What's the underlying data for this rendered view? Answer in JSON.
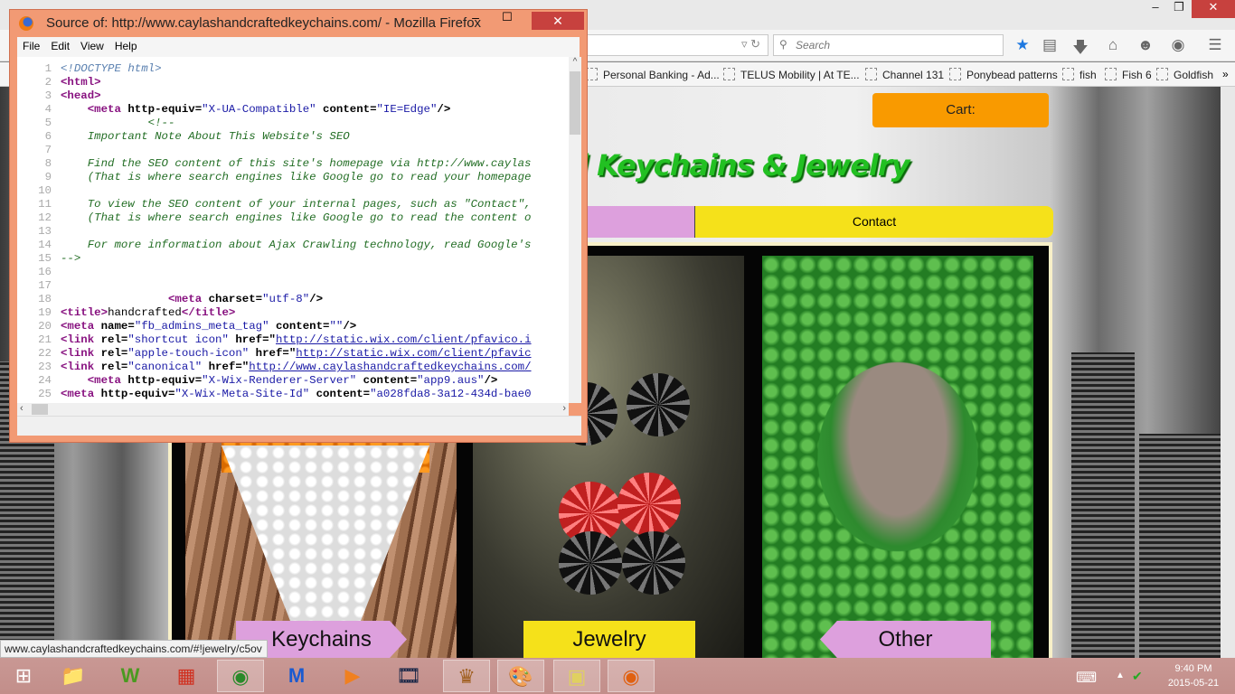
{
  "browser": {
    "search_placeholder": "Search",
    "bookmarks": [
      "Personal Banking - Ad...",
      "TELUS Mobility | At TE...",
      "Channel 131",
      "Ponybead patterns",
      "fish",
      "Fish 6",
      "Goldfish"
    ],
    "bookmarks_overflow": "»",
    "status_url": "www.caylashandcraftedkeychains.com/#!jewelry/c5ov",
    "accent": "#1e78e0"
  },
  "site": {
    "cart_label": "Cart:",
    "title": "l Keychains & Jewelry",
    "nav_contact": "Contact",
    "labels": {
      "keychains": "Keychains",
      "jewelry": "Jewelry",
      "other": "Other"
    },
    "colors": {
      "cart": "#f99a00",
      "title": "#22c022",
      "pink": "#dda0dd",
      "yellow": "#f5e11a"
    }
  },
  "source_window": {
    "title": "Source of: http://www.caylashandcraftedkeychains.com/ - Mozilla Firefox",
    "menu": [
      "File",
      "Edit",
      "View",
      "Help"
    ],
    "close_color": "#c7413e",
    "lines": [
      [
        {
          "t": "dt",
          "v": "<!DOCTYPE html>"
        }
      ],
      [
        {
          "t": "tg",
          "v": "<html>"
        }
      ],
      [
        {
          "t": "tg",
          "v": "<head>"
        }
      ],
      [
        {
          "t": "",
          "v": "    "
        },
        {
          "t": "tg",
          "v": "<meta "
        },
        {
          "t": "at",
          "v": "http-equiv="
        },
        {
          "t": "av",
          "v": "\"X-UA-Compatible\""
        },
        {
          "t": "at",
          "v": " content="
        },
        {
          "t": "av",
          "v": "\"IE=Edge\""
        },
        {
          "t": "at",
          "v": "/>"
        }
      ],
      [
        {
          "t": "cm",
          "v": "             <!--"
        }
      ],
      [
        {
          "t": "cm",
          "v": "    Important Note About This Website's SEO"
        }
      ],
      [],
      [
        {
          "t": "cm",
          "v": "    Find the SEO content of this site's homepage via http://www.caylas"
        }
      ],
      [
        {
          "t": "cm",
          "v": "    (That is where search engines like Google go to read your homepage"
        }
      ],
      [],
      [
        {
          "t": "cm",
          "v": "    To view the SEO content of your internal pages, such as \"Contact\","
        }
      ],
      [
        {
          "t": "cm",
          "v": "    (That is where search engines like Google go to read the content o"
        }
      ],
      [],
      [
        {
          "t": "cm",
          "v": "    For more information about Ajax Crawling technology, read Google's"
        }
      ],
      [
        {
          "t": "cm",
          "v": "-->"
        }
      ],
      [],
      [],
      [
        {
          "t": "",
          "v": "                "
        },
        {
          "t": "tg",
          "v": "<meta "
        },
        {
          "t": "at",
          "v": "charset="
        },
        {
          "t": "av",
          "v": "\"utf-8\""
        },
        {
          "t": "at",
          "v": "/>"
        }
      ],
      [
        {
          "t": "tg",
          "v": "<title>"
        },
        {
          "t": "",
          "v": "handcrafted"
        },
        {
          "t": "tg",
          "v": "</title>"
        }
      ],
      [
        {
          "t": "tg",
          "v": "<meta "
        },
        {
          "t": "at",
          "v": "name="
        },
        {
          "t": "av",
          "v": "\"fb_admins_meta_tag\""
        },
        {
          "t": "at",
          "v": " content="
        },
        {
          "t": "av",
          "v": "\"\""
        },
        {
          "t": "at",
          "v": "/>"
        }
      ],
      [
        {
          "t": "tg",
          "v": "<link "
        },
        {
          "t": "at",
          "v": "rel="
        },
        {
          "t": "av",
          "v": "\"shortcut icon\""
        },
        {
          "t": "at",
          "v": " href=\""
        },
        {
          "t": "lk",
          "v": "http://static.wix.com/client/pfavico.i"
        }
      ],
      [
        {
          "t": "tg",
          "v": "<link "
        },
        {
          "t": "at",
          "v": "rel="
        },
        {
          "t": "av",
          "v": "\"apple-touch-icon\""
        },
        {
          "t": "at",
          "v": " href=\""
        },
        {
          "t": "lk",
          "v": "http://static.wix.com/client/pfavic"
        }
      ],
      [
        {
          "t": "tg",
          "v": "<link "
        },
        {
          "t": "at",
          "v": "rel="
        },
        {
          "t": "av",
          "v": "\"canonical\""
        },
        {
          "t": "at",
          "v": " href=\""
        },
        {
          "t": "lk",
          "v": "http://www.caylashandcraftedkeychains.com/"
        }
      ],
      [
        {
          "t": "",
          "v": "    "
        },
        {
          "t": "tg",
          "v": "<meta "
        },
        {
          "t": "at",
          "v": "http-equiv="
        },
        {
          "t": "av",
          "v": "\"X-Wix-Renderer-Server\""
        },
        {
          "t": "at",
          "v": " content="
        },
        {
          "t": "av",
          "v": "\"app9.aus\""
        },
        {
          "t": "at",
          "v": "/>"
        }
      ],
      [
        {
          "t": "tg",
          "v": "<meta "
        },
        {
          "t": "at",
          "v": "http-equiv="
        },
        {
          "t": "av",
          "v": "\"X-Wix-Meta-Site-Id\""
        },
        {
          "t": "at",
          "v": " content="
        },
        {
          "t": "av",
          "v": "\"a028fda8-3a12-434d-bae0"
        }
      ]
    ]
  },
  "taskbar": {
    "apps": [
      "start",
      "file-explorer",
      "wordweb",
      "avg",
      "chrome",
      "malwarebytes",
      "media-player",
      "video",
      "carousel",
      "paint",
      "sticky-notes",
      "firefox"
    ],
    "time": "9:40 PM",
    "date": "2015-05-21"
  }
}
